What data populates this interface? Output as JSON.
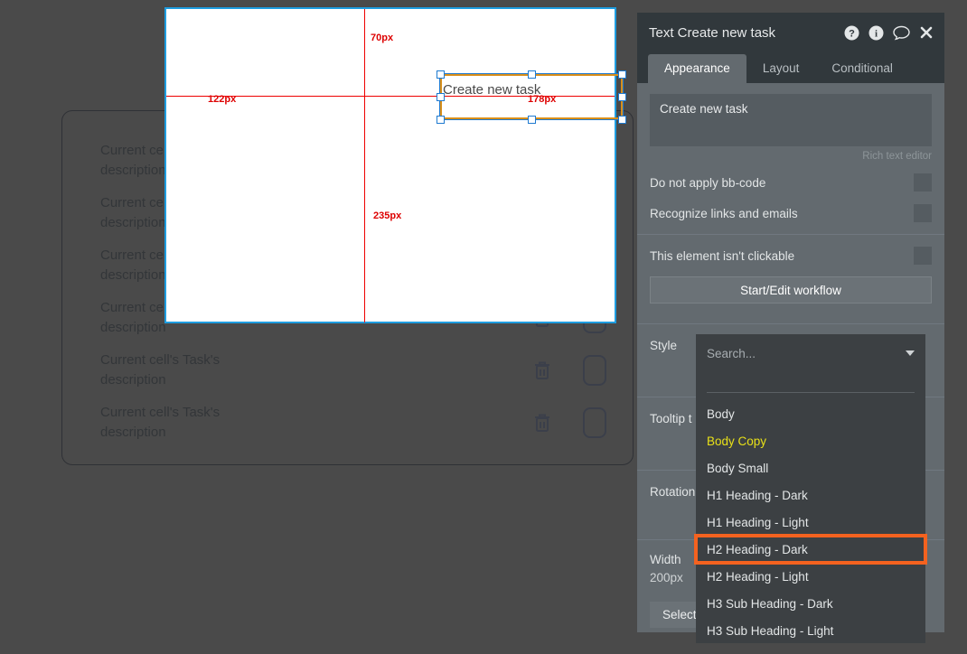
{
  "canvas": {
    "element_text": "Create new task",
    "guides": [
      {
        "name": "top-offset",
        "label": "70px"
      },
      {
        "name": "left-offset",
        "label": "122px"
      },
      {
        "name": "right-offset",
        "label": "178px"
      },
      {
        "name": "bottom-offset",
        "label": "235px"
      }
    ]
  },
  "background": {
    "rows": [
      {
        "text": "Current cell's Task's\ndescription"
      },
      {
        "text": "Current cell's Task's\ndescription"
      },
      {
        "text": "Current cell's Task's\ndescription"
      },
      {
        "text": "Current cell's Task's\ndescription"
      },
      {
        "text": "Current cell's Task's\ndescription"
      },
      {
        "text": "Current cell's Task's\ndescription"
      }
    ]
  },
  "panel": {
    "title": "Text Create new task",
    "header_icons": [
      "help-icon",
      "info-icon",
      "comment-icon",
      "close-icon"
    ],
    "tabs": [
      {
        "label": "Appearance",
        "active": true
      },
      {
        "label": "Layout",
        "active": false
      },
      {
        "label": "Conditional",
        "active": false
      }
    ],
    "rich_text": {
      "value": "Create new task",
      "caption": "Rich text editor"
    },
    "options": [
      {
        "label": "Do not apply bb-code",
        "checked": false
      },
      {
        "label": "Recognize links and emails",
        "checked": false
      },
      {
        "label": "This element isn't clickable",
        "checked": false
      }
    ],
    "workflow_button": "Start/Edit workflow",
    "fields": [
      {
        "label": "Style",
        "value": ""
      },
      {
        "label": "Tooltip t",
        "value": ""
      },
      {
        "label": "Rotation",
        "value": ""
      },
      {
        "label": "Width",
        "value": "200px"
      }
    ],
    "select_button": "Select a"
  },
  "dropdown": {
    "placeholder": "Search...",
    "items": [
      {
        "label": "Body",
        "state": "normal"
      },
      {
        "label": "Body Copy",
        "state": "yellow"
      },
      {
        "label": "Body Small",
        "state": "normal"
      },
      {
        "label": "H1 Heading - Dark",
        "state": "normal"
      },
      {
        "label": "H1 Heading - Light",
        "state": "normal"
      },
      {
        "label": "H2 Heading - Dark",
        "state": "boxed"
      },
      {
        "label": "H2 Heading - Light",
        "state": "normal"
      },
      {
        "label": "H3 Sub Heading - Dark",
        "state": "normal"
      },
      {
        "label": "H3 Sub Heading - Light",
        "state": "normal"
      }
    ]
  },
  "colors": {
    "panel_bg": "#636a6f",
    "header_bg": "#31383c",
    "dropdown_bg": "#3c4043",
    "highlight_orange": "#f4621f",
    "highlight_yellow": "#e8e018",
    "guide_red": "#dd0000",
    "selection_blue": "#1e7ad0",
    "selection_orange": "#d98f1a",
    "canvas_border": "#1e9de0"
  }
}
